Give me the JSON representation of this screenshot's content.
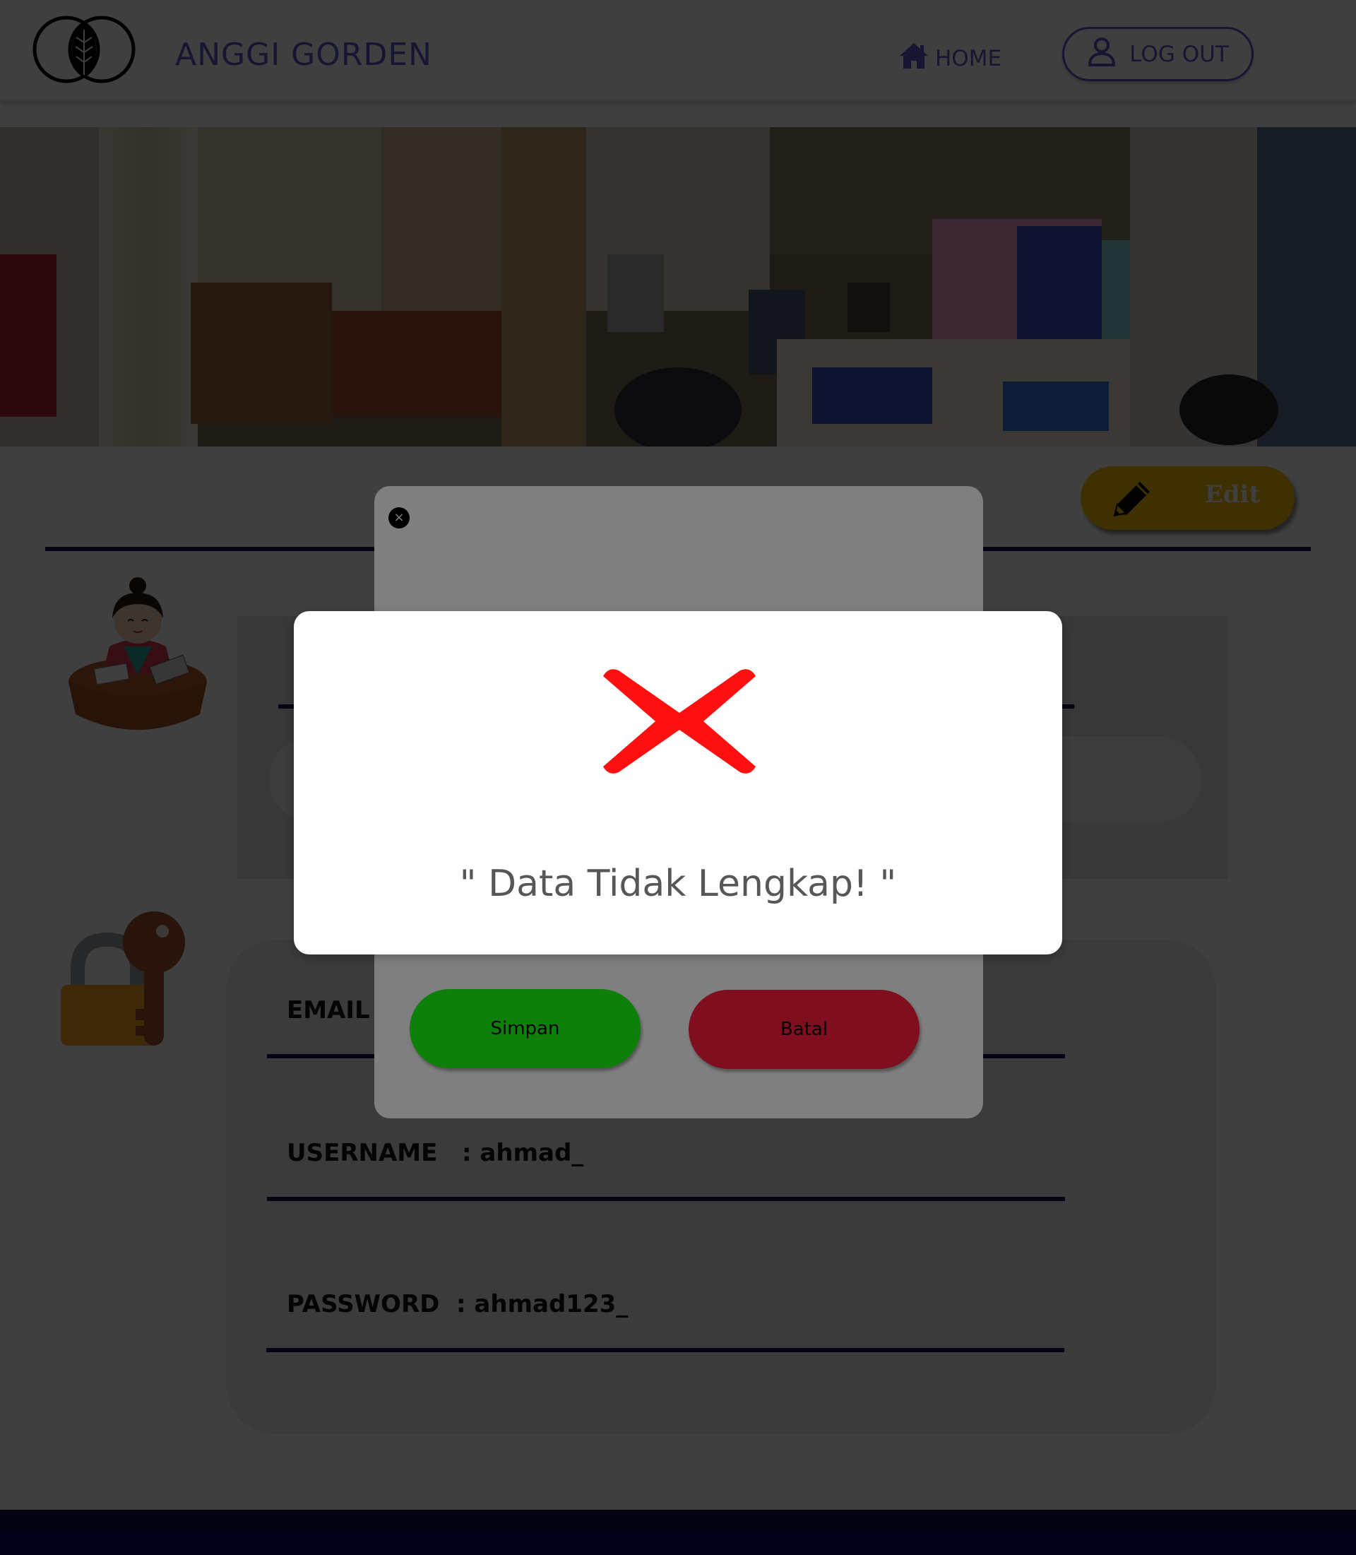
{
  "header": {
    "brand": "ANGGI GORDEN",
    "home_label": "HOME",
    "logout_label": "LOG OUT"
  },
  "profile": {
    "edit_label": "Edit",
    "fields": [
      {
        "label": "EMAIL",
        "value": ""
      },
      {
        "label": "USERNAME",
        "value": ": ahmad_"
      },
      {
        "label": "PASSWORD",
        "value": ": ahmad123_"
      }
    ]
  },
  "edit_modal": {
    "close_symbol": "×",
    "save_label": "Simpan",
    "cancel_label": "Batal"
  },
  "alert": {
    "message": "\" Data Tidak Lengkap! \""
  },
  "colors": {
    "brand": "#5b54c9",
    "edit_button": "#ffc107",
    "save_button": "#1cff12",
    "cancel_button": "#ff1f3d",
    "divider": "#17104f",
    "footer": "#130b62",
    "error_icon": "#ff0000"
  }
}
